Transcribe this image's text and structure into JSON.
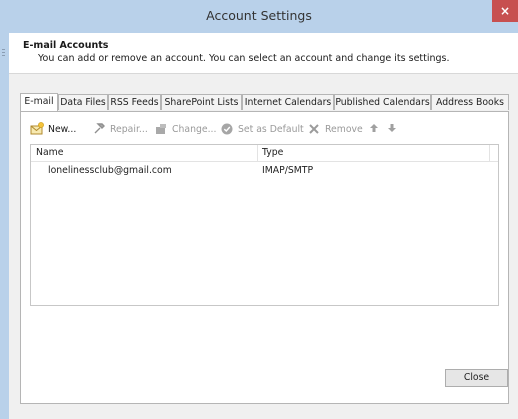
{
  "window": {
    "title": "Account Settings",
    "close_glyph": "×"
  },
  "header": {
    "title": "E-mail Accounts",
    "description": "You can add or remove an account. You can select an account and change its settings."
  },
  "tabs": [
    {
      "label": "E-mail",
      "active": true
    },
    {
      "label": "Data Files",
      "active": false
    },
    {
      "label": "RSS Feeds",
      "active": false
    },
    {
      "label": "SharePoint Lists",
      "active": false
    },
    {
      "label": "Internet Calendars",
      "active": false
    },
    {
      "label": "Published Calendars",
      "active": false
    },
    {
      "label": "Address Books",
      "active": false
    }
  ],
  "toolbar": {
    "new_label": "New...",
    "repair_label": "Repair...",
    "change_label": "Change...",
    "set_default_label": "Set as Default",
    "remove_label": "Remove",
    "move_up_glyph": "🡅",
    "move_down_glyph": "🡇"
  },
  "account_list": {
    "columns": [
      "Name",
      "Type"
    ],
    "rows": [
      {
        "name": "lonelinessclub@gmail.com",
        "type": "IMAP/SMTP"
      }
    ]
  },
  "footer": {
    "close_label": "Close"
  },
  "colors": {
    "titlebar": "#b9d1ea",
    "close_button": "#c75050",
    "panel": "#f0f0f0"
  }
}
